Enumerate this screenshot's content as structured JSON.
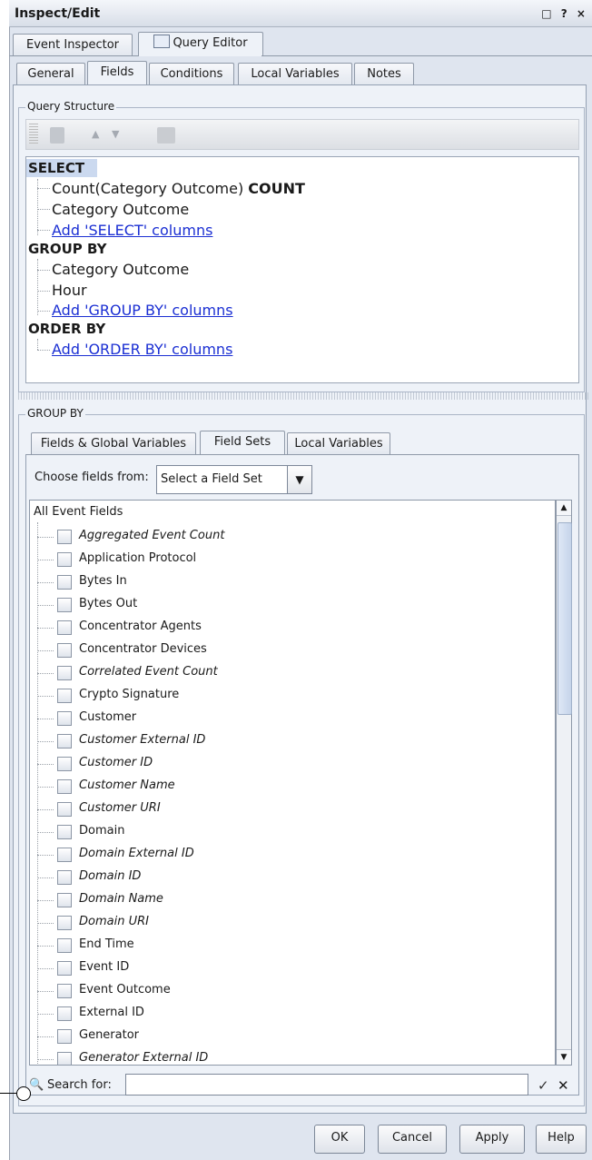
{
  "window": {
    "title": "Inspect/Edit",
    "controls": "□ ? ×"
  },
  "top_tabs": [
    "Event Inspector",
    "Query Editor"
  ],
  "sub_tabs": [
    "General",
    "Fields",
    "Conditions",
    "Local Variables",
    "Notes"
  ],
  "query_structure": {
    "legend": "Query Structure",
    "select_kw": "SELECT",
    "select_items": [
      "Count(Category Outcome)",
      "Category Outcome"
    ],
    "select_count_suffix": "COUNT",
    "add_select": "Add 'SELECT' columns",
    "group_kw": "GROUP BY",
    "group_items": [
      "Category Outcome",
      "Hour"
    ],
    "add_group": "Add 'GROUP BY' columns",
    "order_kw": "ORDER BY",
    "add_order": "Add 'ORDER BY' columns"
  },
  "group_by_panel": {
    "legend": "GROUP BY",
    "tabs": [
      "Fields & Global Variables",
      "Field Sets",
      "Local Variables"
    ],
    "choose_label": "Choose fields from:",
    "choose_value": "Select a Field Set",
    "list_root": "All Event Fields",
    "fields": [
      "Aggregated Event Count",
      "Application Protocol",
      "Bytes In",
      "Bytes Out",
      "Concentrator Agents",
      "Concentrator Devices",
      "Correlated Event Count",
      "Crypto Signature",
      "Customer",
      "Customer External ID",
      "Customer ID",
      "Customer Name",
      "Customer URI",
      "Domain",
      "Domain External ID",
      "Domain ID",
      "Domain Name",
      "Domain URI",
      "End Time",
      "Event ID",
      "Event Outcome",
      "External ID",
      "Generator",
      "Generator External ID"
    ],
    "search_label": "Search for:",
    "search_value": ""
  },
  "buttons": {
    "ok": "OK",
    "cancel": "Cancel",
    "apply": "Apply",
    "help": "Help"
  },
  "icons": {
    "search": "magnifier-icon",
    "confirm": "check-icon",
    "clear": "x-icon"
  }
}
